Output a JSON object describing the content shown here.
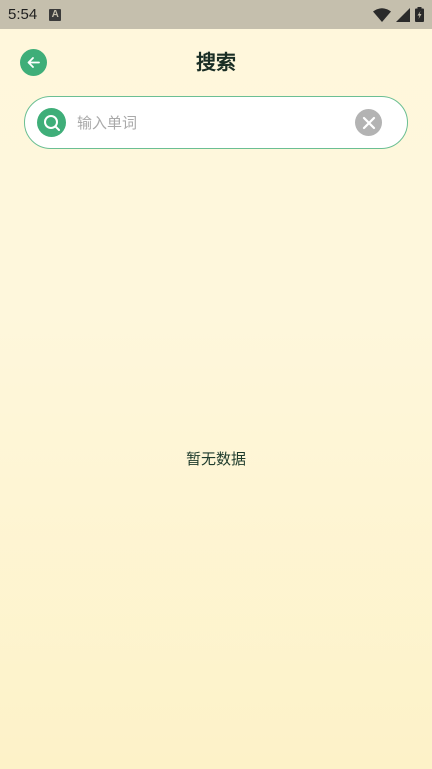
{
  "status_bar": {
    "time": "5:54",
    "notification_icon": "A"
  },
  "header": {
    "title": "搜索",
    "back_icon": "arrow-left-icon"
  },
  "search": {
    "placeholder": "输入单词",
    "value": "",
    "search_icon": "search-icon",
    "clear_icon": "clear-icon"
  },
  "empty_state": {
    "text": "暂无数据"
  },
  "colors": {
    "accent": "#3fae79",
    "border": "#6bbf93",
    "background_top": "#fff7dc",
    "background_bottom": "#fdf2c8",
    "status_bar": "#c5bfad"
  }
}
